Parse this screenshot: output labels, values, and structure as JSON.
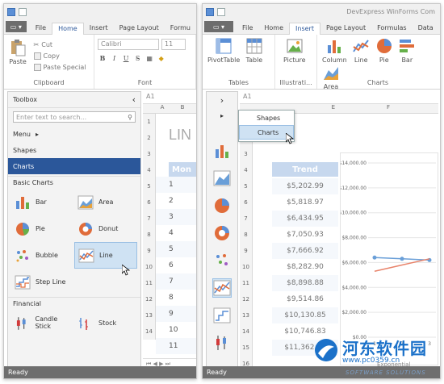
{
  "left": {
    "tabs": [
      "File",
      "Home",
      "Insert",
      "Page Layout",
      "Formu"
    ],
    "active_tab": "Home",
    "clipboard": {
      "paste": "Paste",
      "cut": "Cut",
      "copy": "Copy",
      "paste_special": "Paste Special",
      "group": "Clipboard"
    },
    "font": {
      "name": "Calibri",
      "size": "11",
      "group": "Font",
      "bold": "B",
      "italic": "I",
      "underline": "U"
    },
    "name_box": "A1",
    "col_headers": [
      "A",
      "B"
    ],
    "row_numbers": [
      "1",
      "2",
      "3",
      "4",
      "5",
      "6",
      "7",
      "8",
      "9",
      "10",
      "11",
      "12",
      "13",
      "14"
    ],
    "big_title": "LIN",
    "month_header": "Mon",
    "month_values": [
      "1",
      "2",
      "3",
      "4",
      "5",
      "6",
      "7",
      "8",
      "9",
      "10",
      "11"
    ],
    "status": "Ready"
  },
  "toolbox": {
    "title": "Toolbox",
    "search_placeholder": "Enter text to search...",
    "items": [
      "Menu",
      "Shapes",
      "Charts"
    ],
    "selected": "Charts",
    "basic_section": "Basic Charts",
    "basic_charts": [
      "Bar",
      "Area",
      "Pie",
      "Donut",
      "Bubble",
      "Line",
      "Step Line"
    ],
    "financial_section": "Financial",
    "financial_charts": [
      "Candle Stick",
      "Stock"
    ]
  },
  "right": {
    "title": "DevExpress WinForms Com",
    "tabs": [
      "File",
      "Home",
      "Insert",
      "Page Layout",
      "Formulas",
      "Data"
    ],
    "active_tab": "Insert",
    "tables_buttons": [
      "PivotTable",
      "Table"
    ],
    "tables_group": "Tables",
    "illus_button": "Picture",
    "illus_group": "Illustrati...",
    "charts_buttons": [
      "Column",
      "Line",
      "Pie",
      "Bar",
      "Area"
    ],
    "charts_group": "Charts",
    "name_box": "A1",
    "col_headers": [
      "E",
      "F"
    ],
    "menu": [
      "Shapes",
      "Charts"
    ],
    "menu_highlighted": "Charts",
    "trend_header": "Trend",
    "trend_values": [
      "$5,202.99",
      "$5,818.97",
      "$6,434.95",
      "$7,050.93",
      "$7,666.92",
      "$8,282.90",
      "$8,898.88",
      "$9,514.86",
      "$10,130.85",
      "$10,746.83",
      "$11,362.81"
    ],
    "chart_axis": [
      "$14,000.00",
      "$12,000.00",
      "$10,000.00",
      "$8,000.00",
      "$6,000.00",
      "$4,000.00",
      "$2,000.00",
      "$0.00"
    ],
    "chart_x": [
      "1",
      "2",
      "3"
    ],
    "bottom_label": "Exponential",
    "status": "Ready"
  },
  "chart_data": {
    "type": "line",
    "x": [
      1,
      2,
      3
    ],
    "series": [
      {
        "values": [
          6400,
          6300,
          6200
        ],
        "color": "#6a9fd8"
      },
      {
        "values": [
          5300,
          5800,
          6300
        ],
        "color": "#e8836a"
      }
    ],
    "ylim": [
      0,
      14000
    ],
    "yticks": [
      "$14,000.00",
      "$12,000.00",
      "$10,000.00",
      "$8,000.00",
      "$6,000.00",
      "$4,000.00",
      "$2,000.00",
      "$0.00"
    ],
    "grid": true
  },
  "watermark": {
    "main": "河东软件园",
    "url": "www.pc0359.cn",
    "sub": "SOFTWARE SOLUTIONS"
  }
}
